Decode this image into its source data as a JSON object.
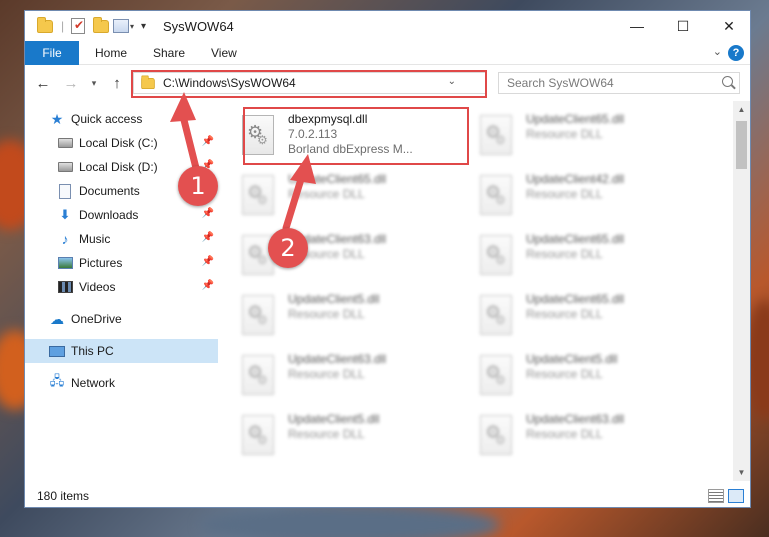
{
  "window": {
    "title": "SysWOW64",
    "controls": {
      "minimize": "—",
      "maximize": "☐",
      "close": "✕"
    }
  },
  "ribbon": {
    "tabs": [
      {
        "label": "File",
        "active": true
      },
      {
        "label": "Home"
      },
      {
        "label": "Share"
      },
      {
        "label": "View"
      }
    ],
    "help_icon": "?"
  },
  "address": {
    "path": "C:\\Windows\\SysWOW64",
    "search_placeholder": "Search SysWOW64"
  },
  "nav": {
    "items": [
      {
        "label": "Quick access",
        "icon": "star-icon",
        "pinned": false
      },
      {
        "label": "Local Disk (C:)",
        "icon": "disk-icon",
        "pinned": true
      },
      {
        "label": "Local Disk (D:)",
        "icon": "disk-icon",
        "pinned": true
      },
      {
        "label": "Documents",
        "icon": "document-icon",
        "pinned": true
      },
      {
        "label": "Downloads",
        "icon": "download-icon",
        "pinned": true
      },
      {
        "label": "Music",
        "icon": "music-icon",
        "pinned": true
      },
      {
        "label": "Pictures",
        "icon": "pictures-icon",
        "pinned": true
      },
      {
        "label": "Videos",
        "icon": "videos-icon",
        "pinned": true
      },
      {
        "label": "OneDrive",
        "icon": "cloud-icon",
        "pinned": false
      },
      {
        "label": "This PC",
        "icon": "computer-icon",
        "pinned": false,
        "selected": true
      },
      {
        "label": "Network",
        "icon": "network-icon",
        "pinned": false
      }
    ]
  },
  "files": [
    {
      "name": "dbexpmysql.dll",
      "version": "7.0.2.113",
      "description": "Borland dbExpress M...",
      "highlighted": true
    },
    {
      "name": "UpdateClient65.dll",
      "description": "Resource DLL"
    },
    {
      "name": "UpdateClient65.dll",
      "description": "Resource DLL"
    },
    {
      "name": "UpdateClient42.dll",
      "description": "Resource DLL"
    },
    {
      "name": "UpdateClient63.dll",
      "description": "Resource DLL"
    },
    {
      "name": "UpdateClient65.dll",
      "description": "Resource DLL"
    },
    {
      "name": "UpdateClient5.dll",
      "description": "Resource DLL"
    },
    {
      "name": "UpdateClient65.dll",
      "description": "Resource DLL"
    },
    {
      "name": "UpdateClient63.dll",
      "description": "Resource DLL"
    },
    {
      "name": "UpdateClient5.dll",
      "description": "Resource DLL"
    },
    {
      "name": "UpdateClient5.dll",
      "description": "Resource DLL"
    },
    {
      "name": "UpdateClient63.dll",
      "description": "Resource DLL"
    }
  ],
  "status": {
    "item_count": "180 items"
  },
  "callouts": {
    "one": "1",
    "two": "2"
  },
  "colors": {
    "accent": "#1979ca",
    "highlight": "#e04848",
    "selected": "#cce4f7"
  }
}
